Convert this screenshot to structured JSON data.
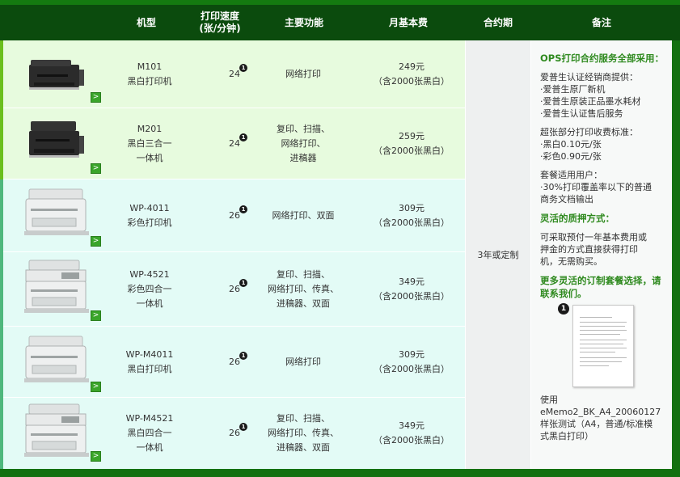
{
  "header": {
    "model": "机型",
    "speed_line1": "打印速度",
    "speed_line2": "(张/分钟)",
    "functions": "主要功能",
    "fee": "月基本费",
    "term": "合约期",
    "notes": "备注"
  },
  "rows": [
    {
      "model_code": "M101",
      "model_type": "黑白打印机",
      "model_type2": "",
      "speed": "24",
      "func1": "网络打印",
      "func2": "",
      "func3": "",
      "fee": "249元",
      "fee_note": "（含2000张黑白）"
    },
    {
      "model_code": "M201",
      "model_type": "黑白三合一",
      "model_type2": "一体机",
      "speed": "24",
      "func1": "复印、扫描、",
      "func2": "网络打印、",
      "func3": "进稿器",
      "fee": "259元",
      "fee_note": "（含2000张黑白）"
    },
    {
      "model_code": "WP-4011",
      "model_type": "彩色打印机",
      "model_type2": "",
      "speed": "26",
      "func1": "网络打印、双面",
      "func2": "",
      "func3": "",
      "fee": "309元",
      "fee_note": "（含2000张黑白）"
    },
    {
      "model_code": "WP-4521",
      "model_type": "彩色四合一",
      "model_type2": "一体机",
      "speed": "26",
      "func1": "复印、扫描、",
      "func2": "网络打印、传真、",
      "func3": "进稿器、双面",
      "fee": "349元",
      "fee_note": "（含2000张黑白）"
    },
    {
      "model_code": "WP-M4011",
      "model_type": "黑白打印机",
      "model_type2": "",
      "speed": "26",
      "func1": "网络打印",
      "func2": "",
      "func3": "",
      "fee": "309元",
      "fee_note": "（含2000张黑白）"
    },
    {
      "model_code": "WP-M4521",
      "model_type": "黑白四合一",
      "model_type2": "一体机",
      "speed": "26",
      "func1": "复印、扫描、",
      "func2": "网络打印、传真、",
      "func3": "进稿器、双面",
      "fee": "349元",
      "fee_note": "（含2000张黑白）"
    }
  ],
  "footnote_marker": "1",
  "arrow_glyph": ">",
  "term_value": "3年或定制",
  "notes": {
    "title": "OPS打印合约服务全部采用：",
    "provider_head": "爱普生认证经销商提供：",
    "provider_1": "·爱普生原厂新机",
    "provider_2": "·爱普生原装正品墨水耗材",
    "provider_3": "·爱普生认证售后服务",
    "overage_head": "超张部分打印收费标准：",
    "overage_1": "·黑白0.10元/张",
    "overage_2": "·彩色0.90元/张",
    "users_head": "套餐适用用户：",
    "users_1": "·30%打印覆盖率以下的普通",
    "users_2": "商务文档输出",
    "deposit_title": "灵活的质押方式：",
    "deposit_1": "可采取预付一年基本费用或",
    "deposit_2": "押金的方式直接获得打印",
    "deposit_3": "机，无需购买。",
    "more_title": "更多灵活的订制套餐选择，请联系我们。",
    "thumb_badge": "1",
    "caption_1": "使用",
    "caption_2": "eMemo2_BK_A4_20060127",
    "caption_3": "样张测试（A4，普通/标准模",
    "caption_4": "式黑白打印）"
  },
  "colors": {
    "header_bg": "#0b4b0d",
    "accent_green": "#2f8a1f",
    "row_green": "#e7fbde",
    "row_mint": "#e3fbf6",
    "arrow_button": "#3aa52a"
  },
  "icons": {
    "printer": "printer-image",
    "arrow": "chevron-right-icon",
    "footnote": "footnote-badge",
    "sample_page": "sample-page-thumbnail"
  }
}
